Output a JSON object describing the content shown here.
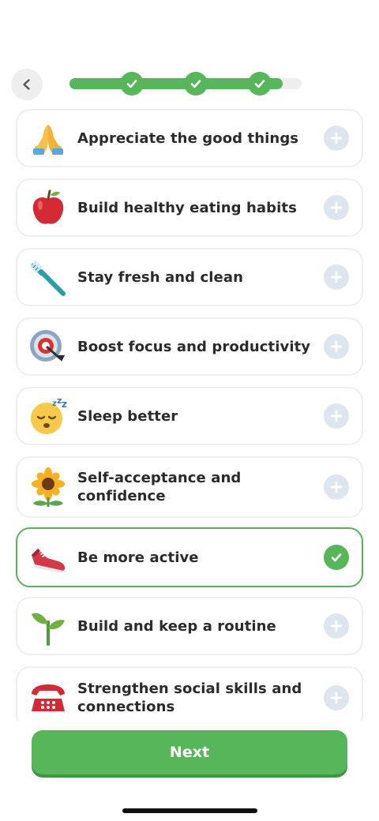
{
  "progress": {
    "value_fraction": 0.92,
    "completed_steps": 3
  },
  "goals": [
    {
      "label": "Appreciate the good things",
      "icon": "folded-hands-icon",
      "selected": false
    },
    {
      "label": "Build healthy eating habits",
      "icon": "apple-icon",
      "selected": false
    },
    {
      "label": "Stay fresh and clean",
      "icon": "toothbrush-icon",
      "selected": false
    },
    {
      "label": "Boost focus and productivity",
      "icon": "target-icon",
      "selected": false
    },
    {
      "label": "Sleep better",
      "icon": "sleeping-face-icon",
      "selected": false
    },
    {
      "label": "Self-acceptance and confidence",
      "icon": "sunflower-icon",
      "selected": false
    },
    {
      "label": "Be more active",
      "icon": "sneaker-icon",
      "selected": true
    },
    {
      "label": "Build and keep a routine",
      "icon": "seedling-icon",
      "selected": false
    },
    {
      "label": "Strengthen social skills and connections",
      "icon": "telephone-icon",
      "selected": false
    }
  ],
  "footer": {
    "next_label": "Next"
  },
  "colors": {
    "accent": "#58b65a",
    "add_button": "#dde6ef",
    "card_border": "#efefef"
  }
}
